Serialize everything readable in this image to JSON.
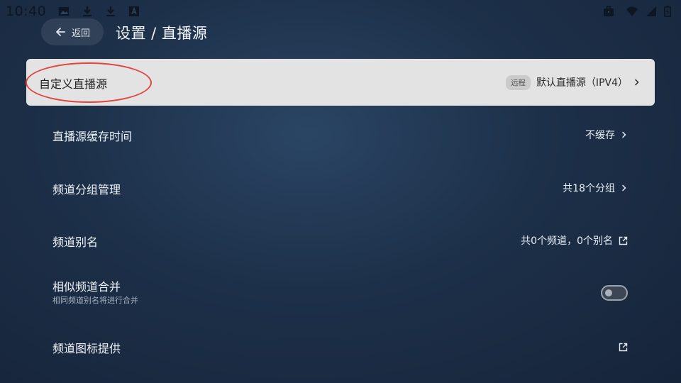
{
  "status_bar": {
    "time": "10:40",
    "left_icons": [
      "image-icon",
      "download-icon",
      "download-icon",
      "text-a-icon"
    ],
    "right_icons": [
      "briefcase-icon",
      "wifi-icon",
      "signal-icon",
      "battery-icon"
    ]
  },
  "header": {
    "back_label": "返回",
    "title": "设置 / 直播源"
  },
  "rows": [
    {
      "label": "自定义直播源",
      "badge": "远程",
      "value": "默认直播源（IPV4）",
      "trailing": "chevron-right-icon",
      "focused": true
    },
    {
      "label": "直播源缓存时间",
      "value": "不缓存",
      "trailing": "chevron-right-icon"
    },
    {
      "label": "频道分组管理",
      "value": "共18个分组",
      "trailing": "chevron-right-icon"
    },
    {
      "label": "频道别名",
      "value": "共0个频道，0个别名",
      "trailing": "open-external-icon"
    },
    {
      "label": "相似频道合并",
      "sub": "相同频道别名将进行合并",
      "toggle": false
    },
    {
      "label": "频道图标提供",
      "trailing": "open-external-icon"
    }
  ],
  "colors": {
    "focus_bg": "#e3e3e3",
    "annotation": "#e0453f"
  }
}
